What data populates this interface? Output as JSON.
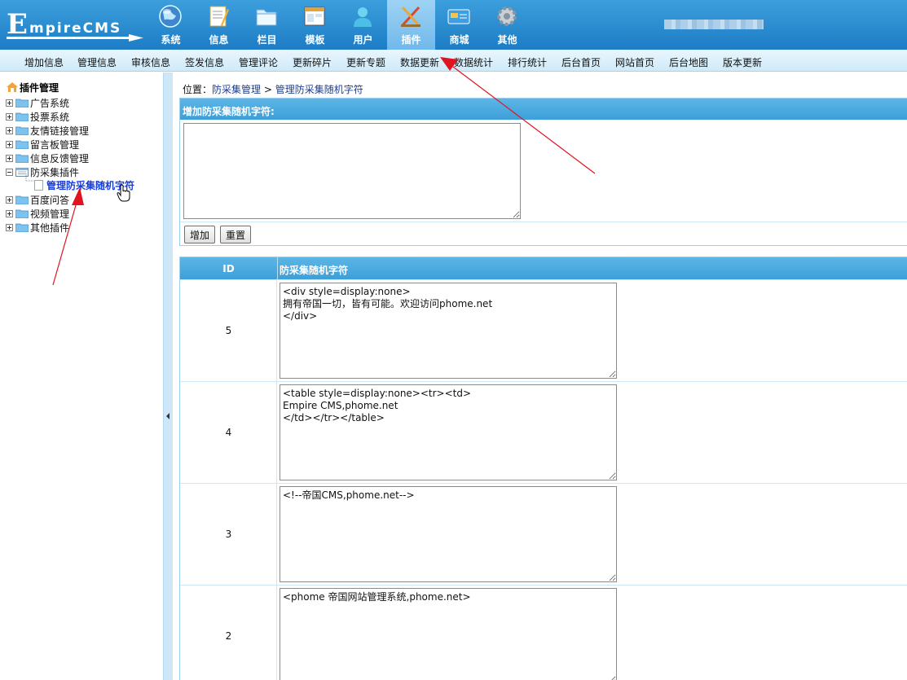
{
  "header": {
    "logo_big": "E",
    "logo_rest": "mpireCMS",
    "nav": [
      {
        "label": "系统",
        "icon": "globe-icon"
      },
      {
        "label": "信息",
        "icon": "notepad-icon"
      },
      {
        "label": "栏目",
        "icon": "folder-icon"
      },
      {
        "label": "模板",
        "icon": "window-icon"
      },
      {
        "label": "用户",
        "icon": "user-icon"
      },
      {
        "label": "插件",
        "icon": "plugin-tools-icon",
        "active": true
      },
      {
        "label": "商城",
        "icon": "card-icon"
      },
      {
        "label": "其他",
        "icon": "gear-icon"
      }
    ]
  },
  "submenu": [
    "增加信息",
    "管理信息",
    "审核信息",
    "签发信息",
    "管理评论",
    "更新碎片",
    "更新专题",
    "数据更新",
    "数据统计",
    "排行统计",
    "后台首页",
    "网站首页",
    "后台地图",
    "版本更新"
  ],
  "tree": {
    "title": "插件管理",
    "nodes": [
      {
        "label": "广告系统",
        "expanded": false
      },
      {
        "label": "投票系统",
        "expanded": false
      },
      {
        "label": "友情链接管理",
        "expanded": false
      },
      {
        "label": "留言板管理",
        "expanded": false
      },
      {
        "label": "信息反馈管理",
        "expanded": false
      },
      {
        "label": "防采集插件",
        "expanded": true
      },
      {
        "label": "百度问答",
        "expanded": false
      },
      {
        "label": "视频管理",
        "expanded": false
      },
      {
        "label": "其他插件",
        "expanded": false
      }
    ],
    "leaf": "管理防采集随机字符"
  },
  "breadcrumb": {
    "prefix": "位置：",
    "part1": "防采集管理",
    "sep": " > ",
    "part2": "管理防采集随机字符"
  },
  "add_form": {
    "title": "增加防采集随机字符:",
    "value": "",
    "add_button": "增加",
    "reset_button": "重置"
  },
  "list": {
    "col_id": "ID",
    "col_value": "防采集随机字符",
    "rows": [
      {
        "id": "5",
        "value": "<div style=display:none>\n拥有帝国一切，皆有可能。欢迎访问phome.net\n</div>"
      },
      {
        "id": "4",
        "value": "<table style=display:none><tr><td>\nEmpire CMS,phome.net\n</td></tr></table>"
      },
      {
        "id": "3",
        "value": "<!--帝国CMS,phome.net-->"
      },
      {
        "id": "2",
        "value": "<phome 帝国网站管理系统,phome.net>"
      }
    ]
  },
  "colors": {
    "header_blue": "#2a8ad0",
    "table_head": "#4aa8de",
    "annotation_red": "#e0141e"
  }
}
